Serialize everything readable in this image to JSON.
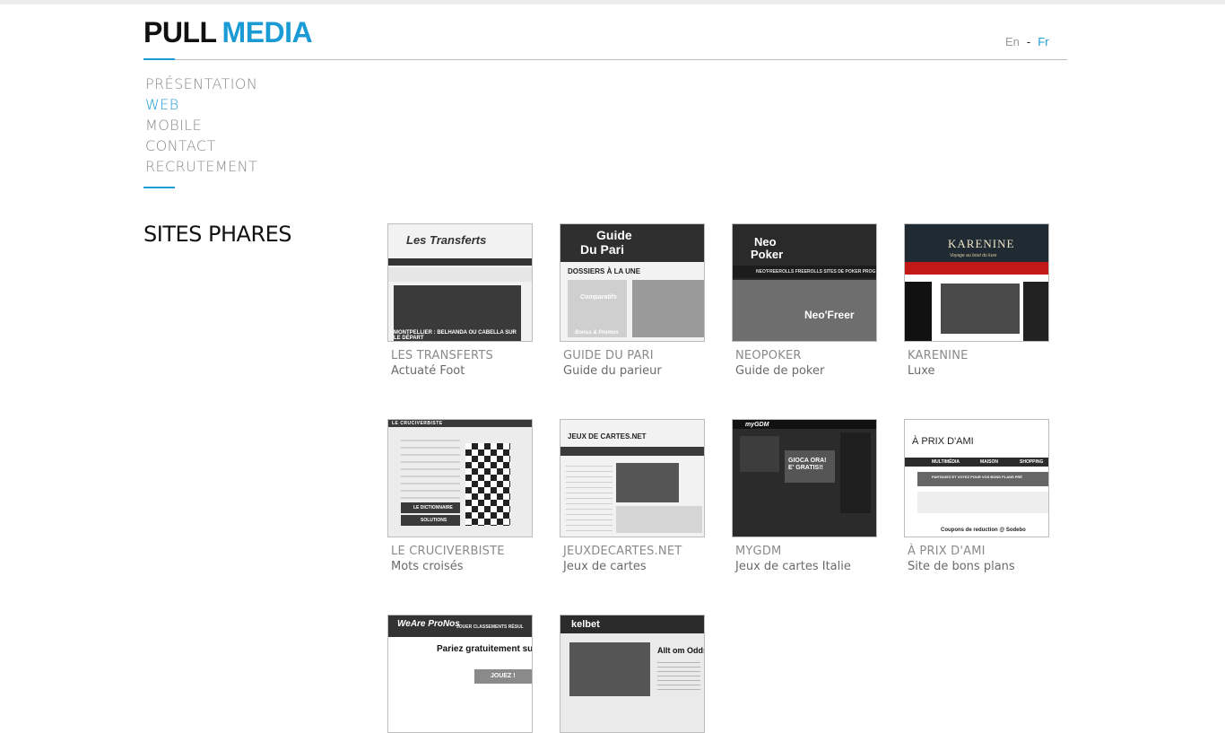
{
  "header": {
    "logo_part1": "PULL",
    "logo_part2": "MEDIA",
    "lang_en": "En",
    "lang_sep": "-",
    "lang_fr": "Fr"
  },
  "nav": {
    "items": [
      {
        "label": "PRÉSENTATION",
        "active": false
      },
      {
        "label": "WEB",
        "active": true
      },
      {
        "label": "MOBILE",
        "active": false
      },
      {
        "label": "CONTACT",
        "active": false
      },
      {
        "label": "RECRUTEMENT",
        "active": false
      }
    ]
  },
  "section": {
    "title": "SITES PHARES"
  },
  "sites": [
    {
      "title": "LES TRANSFERTS",
      "subtitle": "Actuaté Foot"
    },
    {
      "title": "GUIDE DU PARI",
      "subtitle": "Guide du parieur"
    },
    {
      "title": "NEOPOKER",
      "subtitle": "Guide de poker"
    },
    {
      "title": "KARENINE",
      "subtitle": "Luxe"
    },
    {
      "title": "LE CRUCIVERBISTE",
      "subtitle": "Mots croisés"
    },
    {
      "title": "JEUXDECARTES.NET",
      "subtitle": "Jeux de cartes"
    },
    {
      "title": "MYGDM",
      "subtitle": "Jeux de cartes Italie"
    },
    {
      "title": "À PRIX D'AMI",
      "subtitle": "Site de bons plans"
    },
    {
      "title": "",
      "subtitle": ""
    },
    {
      "title": "",
      "subtitle": ""
    }
  ],
  "thumbs": {
    "transferts_logo": "Les Transferts",
    "transferts_headline": "MONTPELLIER : BELHANDA OU CABELLA SUR LE DÉPART",
    "guide_logo_1": "Guide",
    "guide_logo_2": "Du Pari",
    "guide_heading": "DOSSIERS À LA UNE",
    "guide_link_1": "Comparatifs",
    "guide_link_2": "Bonus & Promos",
    "neo_logo_1": "Neo",
    "neo_logo_2": "Poker",
    "neo_menu": "NEO'FREEROLLS   FREEROLLS   SITES DE POKER   PROG",
    "neo_banner": "Neo'Freer",
    "karenine_logo": "KARENINE",
    "karenine_tagline": "Voyage au bout du luxe",
    "cruci_logo": "LE CRUCIVERBISTE",
    "cruci_btn_1": "LE DICTIONNAIRE",
    "cruci_btn_2": "SOLUTIONS",
    "jdc_logo": "JEUX DE CARTES.NET",
    "mygdm_logo": "myGDM",
    "mygdm_banner": "GIOCA ORA! E' GRATIS!!",
    "prix_logo": "À PRIX D'AMI",
    "prix_menu_1": "MULTIMÉDIA",
    "prix_menu_2": "MAISON",
    "prix_menu_3": "SHOPPING",
    "prix_promo": "PARTAGEZ ET VOTEZ POUR VOS BONS PLANS PRÉ",
    "prix_coupon": "Coupons de reduction @ Sodebo",
    "pronos_logo": "WeAre ProNos",
    "pronos_menu": "JOUER   CLASSEMENTS   RÉSUL",
    "pronos_heading": "Pariez gratuitement sur",
    "pronos_btn": "JOUEZ !",
    "kelbet_logo": "kelbet",
    "kelbet_heading": "Allt om Odds"
  }
}
